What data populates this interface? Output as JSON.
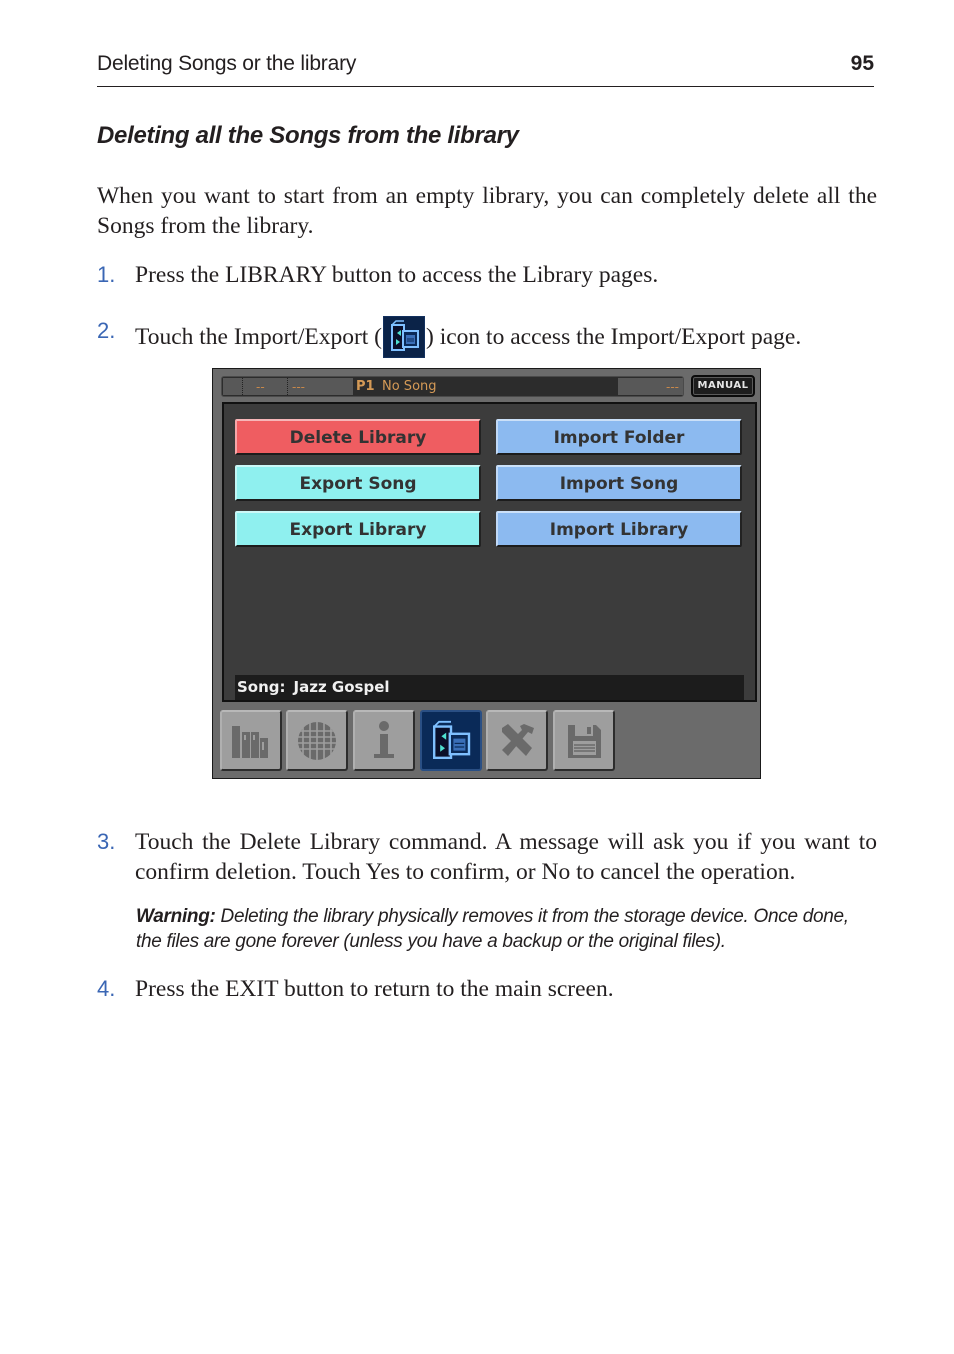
{
  "running_head": {
    "title": "Deleting Songs or the library",
    "page_number": "95"
  },
  "section_heading": "Deleting all the Songs from the library",
  "intro": "When you want to start from an empty library, you can completely delete all the Songs from the library.",
  "steps": [
    {
      "num": "1.",
      "text": "Press the LIBRARY button to access the Library pages."
    },
    {
      "num": "2.",
      "text_before": "Touch the Import/Export (",
      "icon": "import-export-icon",
      "text_after": ") icon to access the Import/Export page."
    },
    {
      "num": "3.",
      "text": "Touch the Delete Library command. A message will ask you if you want to confirm deletion. Touch Yes to confirm, or No to cancel the operation."
    },
    {
      "num": "4.",
      "text": "Press the EXIT button to return to the main screen."
    }
  ],
  "warning": {
    "label": "Warning:",
    "text": " Deleting the library physically removes it from the storage device. Once done, the files are gone forever (unless you have a backup or the original files)."
  },
  "device": {
    "topbar": {
      "seg1": "",
      "seg2": "--",
      "seg3": "---",
      "song_id": "P1",
      "song_title": "No Song",
      "seg4": "---"
    },
    "mode_button": "MANUAL",
    "commands": [
      {
        "label": "Delete Library",
        "color": "#ef5d61"
      },
      {
        "label": "Import Folder",
        "color": "#8cbaf0"
      },
      {
        "label": "Export Song",
        "color": "#8ff0ef"
      },
      {
        "label": "Import Song",
        "color": "#8cbaf0"
      },
      {
        "label": "Export Library",
        "color": "#8ff0ef"
      },
      {
        "label": "Import Library",
        "color": "#8cbaf0"
      }
    ],
    "song_bar": {
      "label": "Song:",
      "value": "Jazz Gospel"
    },
    "tabs": [
      {
        "icon": "library-books-icon",
        "active": false
      },
      {
        "icon": "globe-icon",
        "active": false
      },
      {
        "icon": "info-icon",
        "active": false
      },
      {
        "icon": "import-export-icon",
        "active": true
      },
      {
        "icon": "tools-icon",
        "active": false
      },
      {
        "icon": "save-disk-icon",
        "active": false
      }
    ],
    "colors": {
      "delete": "#ef5d61",
      "export": "#8ff0ef",
      "import": "#8cbaf0",
      "topbar_text": "#d59a56",
      "active_tab": "#0a2a58"
    }
  }
}
